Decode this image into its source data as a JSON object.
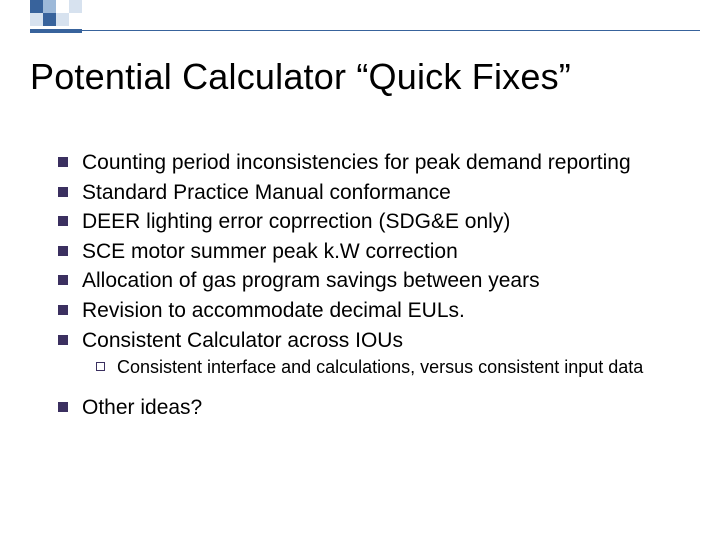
{
  "title": "Potential Calculator “Quick Fixes”",
  "bullets": [
    "Counting period inconsistencies for peak demand reporting",
    "Standard Practice Manual conformance",
    "DEER lighting error coprrection (SDG&E only)",
    "SCE motor summer peak k.W correction",
    "Allocation of gas program savings between years",
    "Revision to accommodate decimal EULs.",
    "Consistent Calculator across IOUs",
    "Other ideas?"
  ],
  "sub_bullets": [
    "Consistent interface and calculations, versus consistent input data"
  ]
}
